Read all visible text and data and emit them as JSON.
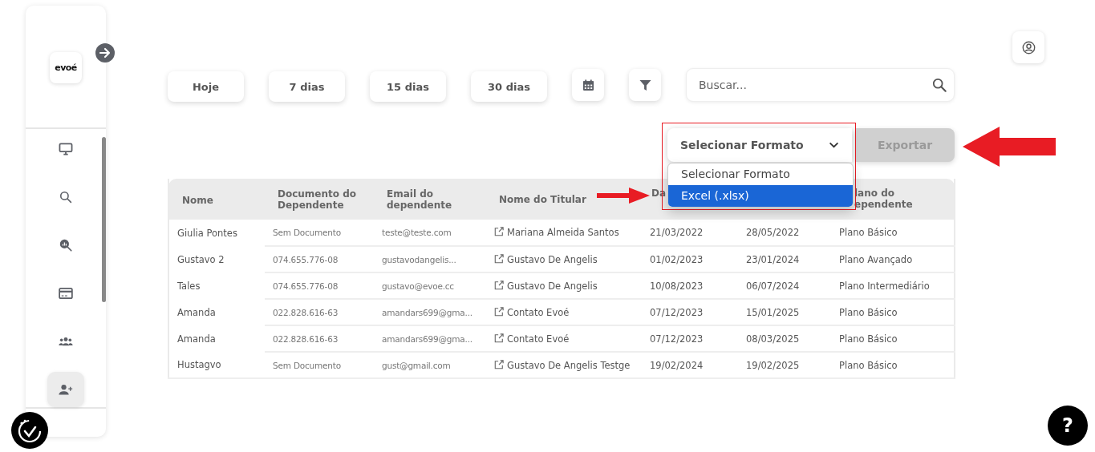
{
  "sidebar": {
    "logo": "evoé",
    "items": [
      {
        "kind": "monitor",
        "selected": false
      },
      {
        "kind": "search",
        "selected": false
      },
      {
        "kind": "chart-search",
        "selected": false
      },
      {
        "kind": "card",
        "selected": false
      },
      {
        "kind": "group",
        "selected": false
      },
      {
        "kind": "user-add",
        "selected": true
      }
    ]
  },
  "period_buttons": [
    {
      "label": "Hoje"
    },
    {
      "label": "7 dias"
    },
    {
      "label": "15 dias"
    },
    {
      "label": "30 dias"
    }
  ],
  "search": {
    "placeholder": "Buscar..."
  },
  "export": {
    "format_select": {
      "value": "Selecionar Formato",
      "expanded": true,
      "options": [
        {
          "label": "Selecionar Formato",
          "highlighted": false
        },
        {
          "label": "Excel (.xlsx)",
          "highlighted": true
        }
      ]
    },
    "button": {
      "label": "Exportar",
      "disabled": true
    }
  },
  "table": {
    "columns": [
      {
        "lines": [
          "Nome"
        ]
      },
      {
        "lines": [
          "Documento do",
          "Dependente"
        ]
      },
      {
        "lines": [
          "Email do",
          "dependente"
        ]
      },
      {
        "lines": [
          "Nome do Titular"
        ]
      },
      {
        "lines": [
          "Da"
        ]
      },
      {},
      {
        "lines": [
          "lano do",
          "ependente"
        ]
      }
    ],
    "rows": [
      [
        "Giulia Pontes",
        "Sem Documento",
        "teste@teste.com",
        "Mariana Almeida Santos",
        "21/03/2022",
        "28/05/2022",
        "Plano Básico"
      ],
      [
        "Gustavo 2",
        "074.655.776-08",
        "gustavodangelis...",
        "Gustavo De Angelis",
        "01/02/2023",
        "23/01/2024",
        "Plano Avançado"
      ],
      [
        "Tales",
        "074.655.776-08",
        "gustavo@evoe.cc",
        "Gustavo De Angelis",
        "10/08/2023",
        "06/07/2024",
        "Plano Intermediário"
      ],
      [
        "Amanda",
        "022.828.616-63",
        "amandars699@gma...",
        "Contato Evoé",
        "07/12/2023",
        "15/01/2025",
        "Plano Básico"
      ],
      [
        "Amanda",
        "022.828.616-63",
        "amandars699@gma...",
        "Contato Evoé",
        "07/12/2023",
        "08/03/2025",
        "Plano Básico"
      ],
      [
        "Hustagvo",
        "Sem Documento",
        "gust@gmail.com",
        "Gustavo De Angelis Testge",
        "19/02/2024",
        "19/02/2025",
        "Plano Básico"
      ]
    ]
  },
  "help_button": {
    "label": "?"
  }
}
